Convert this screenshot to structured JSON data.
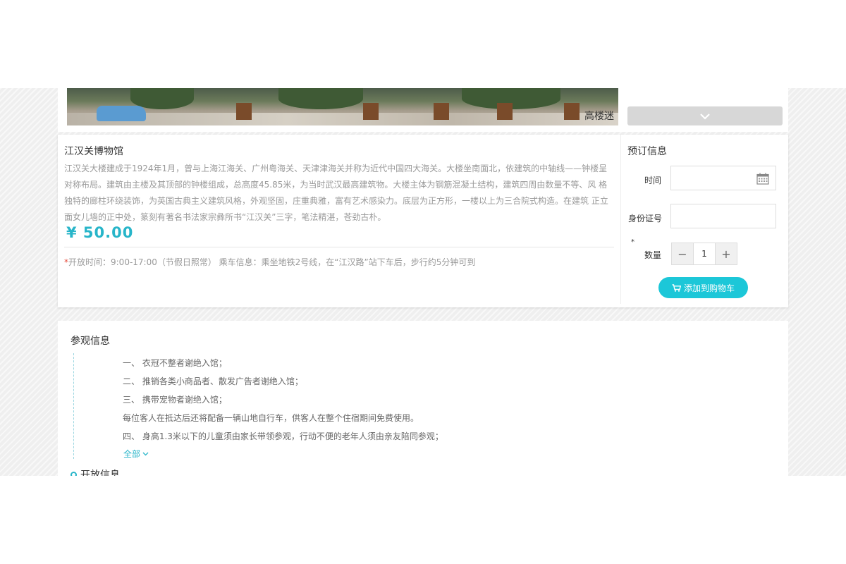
{
  "banner": {
    "watermark": "高楼迷",
    "nav_icon": "chevron-down-icon"
  },
  "product": {
    "title": "江汉关博物馆",
    "description": "江汉关大楼建成于1924年1月，曾与上海江海关、广州粤海关、天津津海关并称为近代中国四大海关。大楼坐南面北，依建筑的中轴线——钟楼呈对称布局。建筑由主楼及其顶部的钟楼组成，总高度45.85米，为当时武汉最高建筑物。大楼主体为钢筋混凝土结构，建筑四周由数量不等、风 格独特的廊柱环绕装饰，为英国古典主义建筑风格，外观坚固，庄重典雅，富有艺术感染力。底层为正方形，一楼以上为三合院式构造。在建筑 正立面女儿墙的正中处，篆刻有著名书法家宗彝所书“江汉关”三字，笔法精湛，苍劲古朴。",
    "price": "¥ 50.00",
    "required_mark": "*",
    "open_info": "开放时间：9:00-17:00（节假日照常） 乘车信息：乘坐地铁2号线，在“江汉路”站下车后，步行约5分钟可到"
  },
  "booking": {
    "title": "预订信息",
    "time_label": "时间",
    "time_value": "",
    "id_label": "身份证号",
    "id_value": "",
    "qty_required": "*",
    "qty_label": "数量",
    "qty_minus": "−",
    "qty_value": "1",
    "qty_plus": "+",
    "cart_label": "添加到购物车",
    "calendar_icon": "calendar-icon",
    "cart_icon": "cart-icon"
  },
  "visit": {
    "title": "参观信息",
    "rules": [
      "一、 衣冠不整者谢绝入馆；",
      "二、 推销各类小商品者、散发广告者谢绝入馆；",
      "三、 携带宠物者谢绝入馆；",
      "每位客人在抵达后还将配备一辆山地自行车，供客人在整个住宿期间免费使用。",
      "四、 身高1.3米以下的儿童须由家长带领参观，行动不便的老年人须由亲友陪同参观；"
    ],
    "more_label": "全部",
    "next_section": "开放信息"
  },
  "colors": {
    "accent": "#1cc7d8",
    "price": "#27b5c9",
    "required": "#e74c3c"
  }
}
